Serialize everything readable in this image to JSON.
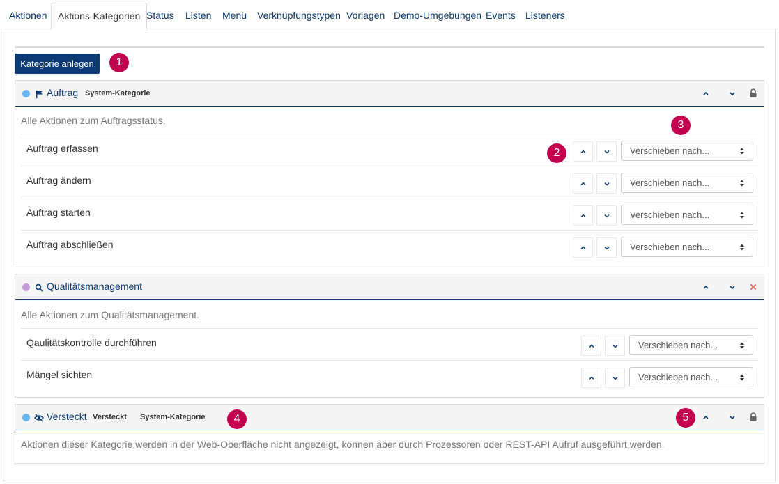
{
  "tabs": [
    {
      "label": "Aktionen",
      "active": false
    },
    {
      "label": "Aktions-Kategorien",
      "active": true
    },
    {
      "label": "Status",
      "active": false
    },
    {
      "label": "Listen",
      "active": false
    },
    {
      "label": "Menü",
      "active": false
    },
    {
      "label": "Verknüpfungstypen",
      "active": false
    },
    {
      "label": "Vorlagen",
      "active": false
    },
    {
      "label": "Demo-Umgebungen",
      "active": false
    },
    {
      "label": "Events",
      "active": false
    },
    {
      "label": "Listeners",
      "active": false
    }
  ],
  "create_button": "Kategorie anlegen",
  "callouts": [
    "1",
    "2",
    "3",
    "4",
    "5"
  ],
  "move_placeholder": "Verschieben nach...",
  "colors": {
    "brand": "#0b3a74",
    "callout": "#c3004f",
    "dot_blue": "#6cb4ee",
    "dot_purple": "#c39bd3",
    "delete": "#d9534f"
  },
  "categories": [
    {
      "title": "Auftrag",
      "icon": "flag-icon",
      "dot_color": "#6cb4ee",
      "tags": [
        "System-Kategorie"
      ],
      "trailing_icon": "lock-icon",
      "description": "Alle Aktionen zum Auftragsstatus.",
      "actions": [
        "Auftrag erfassen",
        "Auftrag ändern",
        "Auftrag starten",
        "Auftrag abschließen"
      ]
    },
    {
      "title": "Qualitätsmanagement",
      "icon": "search-icon",
      "dot_color": "#c39bd3",
      "tags": [],
      "trailing_icon": "delete-icon",
      "description": "Alle Aktionen zum Qualitätsmanagement.",
      "actions": [
        "Qaulitätskontrolle durchführen",
        "Mängel sichten"
      ]
    },
    {
      "title": "Versteckt",
      "icon": "eye-slash-icon",
      "dot_color": "#6cb4ee",
      "tags": [
        "Versteckt",
        "System-Kategorie"
      ],
      "trailing_icon": "lock-icon",
      "description": "Aktionen dieser Kategorie werden in der Web-Oberfläche nicht angezeigt, können aber durch Prozessoren oder REST-API Aufruf ausgeführt werden.",
      "actions": []
    }
  ]
}
